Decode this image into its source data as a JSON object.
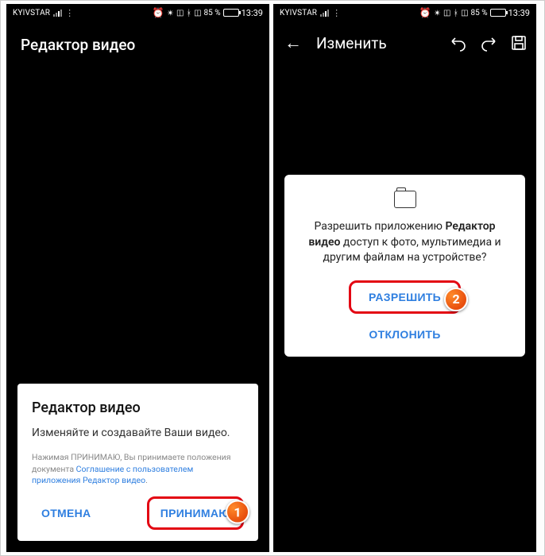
{
  "status": {
    "carrier": "KYIVSTAR",
    "battery_pct": "85 %",
    "time": "13:39"
  },
  "left": {
    "app_title": "Редактор видео",
    "dialog": {
      "title": "Редактор видео",
      "subtitle": "Изменяйте и создавайте Ваши видео.",
      "fine_prefix": "Нажимая ПРИНИМАЮ, Вы принимаете положения документа ",
      "fine_link": "Соглашение с пользователем приложения Редактор видео",
      "cancel": "ОТМЕНА",
      "accept": "ПРИНИМАЮ"
    },
    "badge": "1"
  },
  "right": {
    "header": {
      "title": "Изменить"
    },
    "perm": {
      "text_before": "Разрешить приложению ",
      "app_bold": "Редактор видео",
      "text_after": " доступ к фото, мультимедиа и другим файлам на устройстве?",
      "allow": "РАЗРЕШИТЬ",
      "deny": "ОТКЛОНИТЬ"
    },
    "badge": "2"
  }
}
